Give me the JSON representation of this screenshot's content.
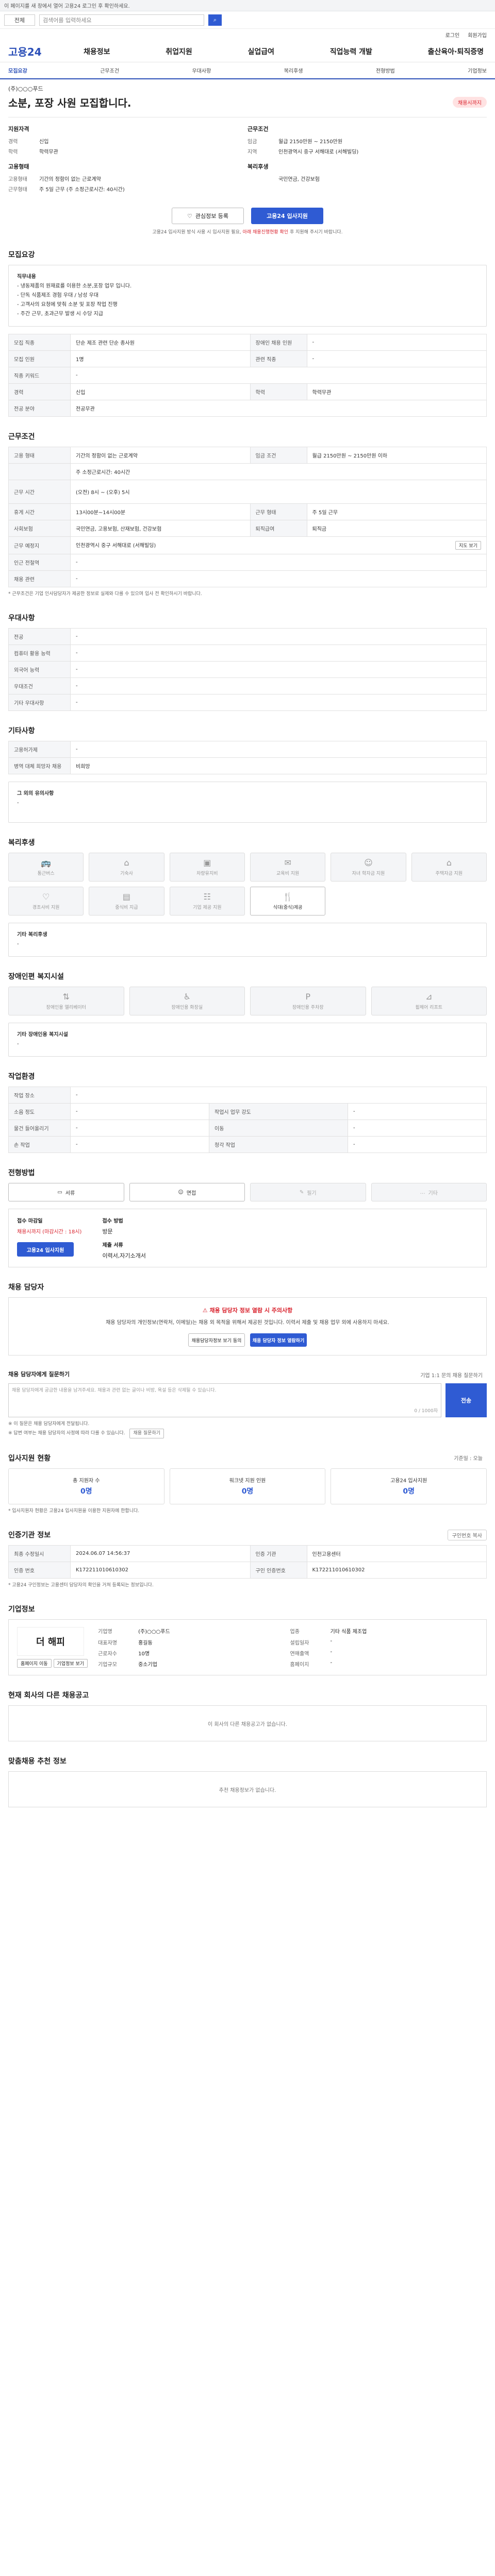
{
  "topbar": {
    "notice": "이 페이지를 새 창에서 열어 고용24 로그인 후 확인하세요."
  },
  "search": {
    "category": "전체",
    "placeholder": "검색어를 입력하세요"
  },
  "util": [
    "로그인",
    "회원가입"
  ],
  "brand": {
    "logo": "고용24"
  },
  "gnb": [
    "채용정보",
    "취업지원",
    "실업급여",
    "직업능력 개발",
    "출산육아·퇴직증명"
  ],
  "tabs": [
    {
      "label": "모집요강",
      "active": true
    },
    {
      "label": "근무조건",
      "active": false
    },
    {
      "label": "우대사항",
      "active": false
    },
    {
      "label": "복리후생",
      "active": false
    },
    {
      "label": "전형방법",
      "active": false
    },
    {
      "label": "기업정보",
      "active": false
    }
  ],
  "job": {
    "company": "(주)○○○푸드",
    "title": "소분, 포장 사원 모집합니다.",
    "status": "채용시까지"
  },
  "summary": {
    "left_title": "지원자격",
    "left_rows": [
      {
        "k": "경력",
        "v": "신입"
      },
      {
        "k": "학력",
        "v": "학력무관"
      }
    ],
    "left_title2": "고용형태",
    "left_rows2": [
      {
        "k": "고용형태",
        "v": "기간의 정함이 없는 근로계약"
      },
      {
        "k": "근무형태",
        "v": "주 5일 근무 (주 소정근로시간: 40시간)"
      }
    ],
    "right_title": "근무조건",
    "right_rows": [
      {
        "k": "임금",
        "v": "월급 2150만원 ~ 2150만원"
      },
      {
        "k": "지역",
        "v": "인천광역시 중구 서해대로 (서해빌딩)"
      }
    ],
    "right_title2": "복리후생",
    "right_rows2": [
      {
        "k": "",
        "v": "국민연금, 건강보험"
      }
    ]
  },
  "actions": {
    "scrap": "관심정보 등록",
    "apply": "고용24 입사지원"
  },
  "notice_line": {
    "text": "고용24 입사지원 방식 사용 시 입사지원 필요, ",
    "emph": "아래 채용진행현황 확인",
    "tail": " 후 지원해 주시기 바랍니다."
  },
  "recruit": {
    "title": "모집요강",
    "desc_h": "직무내용",
    "desc": [
      "- 냉동제품의 원재료를 이용한 소분,포장 업무 입니다.",
      "- 단독 식품제조 경험 우대 / 남성 우대",
      "- 고객사의 요청에 맞춰 소분 및 포장 작업 진행",
      "- 주간 근무, 초과근무 발생 시 수당 지급"
    ],
    "rows": [
      {
        "k": "모집 직종",
        "v": "단순 제조 관련 단순 종사원",
        "k2": "장애인 채용 인원",
        "v2": "-"
      },
      {
        "k": "모집 인원",
        "v": "1명",
        "k2": "관련 직종",
        "v2": "-"
      },
      {
        "k": "직종 키워드",
        "v": "-",
        "k2": "",
        "v2": ""
      },
      {
        "k": "경력",
        "v": "신입",
        "k2": "학력",
        "v2": "학력무관"
      },
      {
        "k": "전공 분야",
        "v": "전공무관",
        "k2": "",
        "v2": ""
      }
    ]
  },
  "work": {
    "title": "근무조건",
    "rows": [
      {
        "k": "고용 형태",
        "v": "기간의 정함이 없는 근로계약",
        "k2": "임금 조건",
        "v2": "월급 2150만원 ~ 2150만원 이하"
      },
      {
        "k": "",
        "v": "주 소정근로시간: 40시간",
        "k2": "",
        "v2": ""
      },
      {
        "k": "근무 시간",
        "v": "(오전) 8시 ~ (오후) 5시",
        "k2": "",
        "v2": ""
      },
      {
        "k": "휴게 시간",
        "v": "13시00분~14시00분",
        "k2": "근무 형태",
        "v2": "주 5일 근무"
      },
      {
        "k": "사회보험",
        "v": "국민연금, 고용보험, 산재보험, 건강보험",
        "k2": "퇴직급여",
        "v2": "퇴직금"
      },
      {
        "k": "근무 예정지",
        "v": "인천광역시 중구 서해대로 (서해빌딩)",
        "k2": "",
        "v2": ""
      },
      {
        "k": "인근 전철역",
        "v": "-",
        "k2": "",
        "v2": ""
      },
      {
        "k": "채용 관련",
        "v": "-",
        "k2": "",
        "v2": ""
      }
    ],
    "map_btn": "지도 보기",
    "note": "* 근무조건은 기업 인사담당자가 제공한 정보로 실제와 다를 수 있으며 입사 전 확인하시기 바랍니다."
  },
  "pref": {
    "title": "우대사항",
    "rows": [
      {
        "k": "전공",
        "v": "-"
      },
      {
        "k": "컴퓨터 활용 능력",
        "v": "-"
      },
      {
        "k": "외국어 능력",
        "v": "-"
      },
      {
        "k": "우대조건",
        "v": "-"
      },
      {
        "k": "기타 우대사항",
        "v": "-"
      }
    ]
  },
  "etc": {
    "title": "기타사항",
    "rows": [
      {
        "k": "고용허가제",
        "v": "-"
      },
      {
        "k": "병역 대체 희망자 채용",
        "v": "비희망"
      }
    ],
    "box_title": "그 외의 유의사항",
    "box_text": "-"
  },
  "welfare": {
    "title": "복리후생",
    "items": [
      {
        "icon": "bus-icon",
        "label": "통근버스",
        "on": false
      },
      {
        "icon": "home-icon",
        "label": "기숙사",
        "on": false
      },
      {
        "icon": "food-icon",
        "label": "차량유지비",
        "on": false
      },
      {
        "icon": "gift-icon",
        "label": "교육비 지원",
        "on": false
      },
      {
        "icon": "child-icon",
        "label": "자녀 학자금 지원",
        "on": false
      },
      {
        "icon": "house-icon",
        "label": "주택자금 지원",
        "on": false
      },
      {
        "icon": "heart-icon",
        "label": "경조사비 지원",
        "on": false
      },
      {
        "icon": "book-icon",
        "label": "중식비 지급",
        "on": false
      },
      {
        "icon": "users-icon",
        "label": "기업 제공 지원",
        "on": false
      },
      {
        "icon": "meal-icon",
        "label": "식대(중식)제공",
        "on": true
      }
    ],
    "box_title": "기타 복리후생",
    "box_text": "-"
  },
  "disabled": {
    "title": "장애인편 복지시설",
    "items": [
      {
        "icon": "elevator-icon",
        "label": "장애인용 엘리베이터"
      },
      {
        "icon": "toilet-icon",
        "label": "장애인용 화장실"
      },
      {
        "icon": "parking-icon",
        "label": "장애인용 주차장"
      },
      {
        "icon": "ramp-icon",
        "label": "휠체어 리프트"
      }
    ],
    "box_title": "기타 장애인용 복지시설",
    "box_text": "-"
  },
  "workenv": {
    "title": "작업환경",
    "rows": [
      {
        "k": "작업 장소",
        "v": "-",
        "k2": "",
        "v2": ""
      },
      {
        "k": "소음 정도",
        "v": "-",
        "k2": "작업시 업무 강도",
        "v2": "-"
      },
      {
        "k": "물건 들어올리기",
        "v": "-",
        "k2": "이동",
        "v2": "-"
      },
      {
        "k": "손 작업",
        "v": "-",
        "k2": "청각 작업",
        "v2": "-"
      }
    ]
  },
  "process": {
    "title": "전형방법",
    "steps": [
      {
        "icon": "doc-icon",
        "label": "서류",
        "on": true
      },
      {
        "icon": "talk-icon",
        "label": "면접",
        "on": true
      },
      {
        "icon": "test-icon",
        "label": "필기",
        "on": false
      },
      {
        "icon": "etc-icon",
        "label": "기타",
        "on": false
      }
    ],
    "deadline_label": "접수 마감일",
    "deadline_value": "채용시까지 (마감시간 : 18시)",
    "method_label": "접수 방법",
    "method_value": "방문",
    "method_label2": "제출 서류",
    "method_value2": "이력서,자기소개서",
    "apply_btn": "고용24 입사지원"
  },
  "contact": {
    "title": "채용 담당자",
    "warn_title": "채용 담당자 정보 열람 시 주의사항",
    "warn_text": "채용 담당자의 개인정보(연락처, 이메일)는 채용 외 목적을 위해서 제공된 것입니다. 이력서 제출 및 채용 업무 외에 사용하지 마세요.",
    "btn1": "채용담당자정보 보기 동의",
    "btn2": "채용 담당자 정보 열람하기"
  },
  "qna": {
    "title": "채용 담당자에게 질문하기",
    "sub": "기업 1:1 문의 채용 질문하기",
    "placeholder": "채용 담당자에게 궁금한 내용을 남겨주세요. 채용과 관련 없는 글이나 비방, 욕설 등은 삭제될 수 있습니다.",
    "count": "0 / 1000자",
    "send": "전송",
    "notes": [
      "※ 이 질문은 채용 담당자에게 전달됩니다.",
      "※ 답변 여부는 채용 담당자의 사정에 따라 다를 수 있습니다."
    ],
    "more": "채용 질문하기"
  },
  "stats": {
    "title": "입사지원 현황",
    "total": "기준일 : 오늘",
    "items": [
      {
        "label": "총 지원자 수",
        "value": "0명"
      },
      {
        "label": "워크넷 지원 인원",
        "value": "0명"
      },
      {
        "label": "고용24 입사지원",
        "value": "0명"
      }
    ],
    "note": "* 입사지원자 현황은 고용24 입사지원을 이용한 지원자에 한합니다."
  },
  "auth": {
    "title": "인증기관 정보",
    "rows": [
      {
        "k": "최종 수정일시",
        "v": "2024.06.07 14:56:37",
        "k2": "인증 기관",
        "v2": "인천고용센터"
      },
      {
        "k": "인증 번호",
        "v": "K172211010610302",
        "k2": "구인 인증번호",
        "v2": "K172211010610302"
      }
    ],
    "copy_btn": "구인번호 복사",
    "note": "* 고용24 구인정보는 고용센터 담당자의 확인을 거쳐 등록되는 정보입니다."
  },
  "company": {
    "title": "기업정보",
    "logo_text": "더 해피",
    "logo_btn1": "홈페이지 이동",
    "logo_btn2": "기업정보 보기",
    "info": [
      {
        "k": "기업명",
        "v": "(주)○○○푸드"
      },
      {
        "k": "업종",
        "v": "기타 식품 제조업"
      },
      {
        "k": "대표자명",
        "v": "홍길동"
      },
      {
        "k": "설립일자",
        "v": "-"
      },
      {
        "k": "근로자수",
        "v": "10명"
      },
      {
        "k": "연매출액",
        "v": "-"
      },
      {
        "k": "기업규모",
        "v": "중소기업"
      },
      {
        "k": "홈페이지",
        "v": "-"
      }
    ]
  },
  "same_company": {
    "title": "현재 회사의 다른 채용공고",
    "empty": "이 회사의 다른 채용공고가 없습니다."
  },
  "recommend": {
    "title": "맞춤채용 추천 정보",
    "empty": "추천 채용정보가 없습니다."
  }
}
